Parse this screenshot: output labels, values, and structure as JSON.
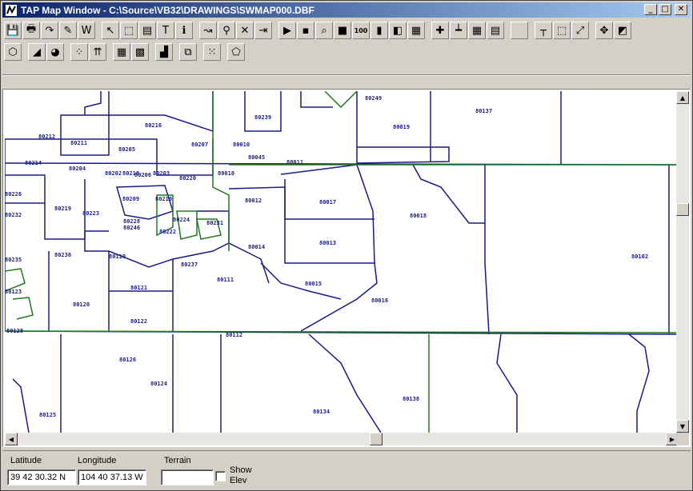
{
  "window": {
    "title": "TAP Map Window - C:\\Source\\VB32\\DRAWINGS\\SWMAP000.DBF",
    "min_label": "_",
    "max_label": "□",
    "close_label": "✕"
  },
  "toolbar1": [
    {
      "name": "save-icon",
      "glyph": "💾"
    },
    {
      "name": "print-icon",
      "glyph": "🖶"
    },
    {
      "name": "redo-icon",
      "glyph": "↷"
    },
    {
      "name": "edit-icon",
      "glyph": "✎"
    },
    {
      "name": "w-icon",
      "glyph": "W"
    },
    {
      "name": "pointer-icon",
      "glyph": "↖"
    },
    {
      "name": "select-icon",
      "glyph": "⬚"
    },
    {
      "name": "record-icon",
      "glyph": "▤"
    },
    {
      "name": "text-icon",
      "glyph": "T"
    },
    {
      "name": "info-icon",
      "glyph": "ℹ"
    },
    {
      "name": "route-icon",
      "glyph": "↝"
    },
    {
      "name": "search-map-icon",
      "glyph": "⚲"
    },
    {
      "name": "delete-icon",
      "glyph": "✕"
    },
    {
      "name": "exit-icon",
      "glyph": "⇥"
    },
    {
      "name": "green-select-icon",
      "glyph": "▶"
    },
    {
      "name": "green-dot-icon",
      "glyph": "▪"
    },
    {
      "name": "zoom-in-icon",
      "glyph": "⌕"
    },
    {
      "name": "red-box-icon",
      "glyph": "■"
    },
    {
      "name": "zoom-100-icon",
      "glyph": "100"
    },
    {
      "name": "yellow-icon",
      "glyph": "▮"
    },
    {
      "name": "layers-icon",
      "glyph": "◧"
    },
    {
      "name": "green-grid-icon",
      "glyph": "▦"
    },
    {
      "name": "crosshair-plus-icon",
      "glyph": "✚"
    },
    {
      "name": "ruler-icon",
      "glyph": "┷"
    },
    {
      "name": "grid-icon",
      "glyph": "▦"
    },
    {
      "name": "notepad-icon",
      "glyph": "▤"
    },
    {
      "name": "blank-icon",
      "glyph": ""
    },
    {
      "name": "corner-icon",
      "glyph": "┬"
    },
    {
      "name": "zoom-box-icon",
      "glyph": "⬚"
    },
    {
      "name": "expand-icon",
      "glyph": "⤢"
    },
    {
      "name": "move-icon",
      "glyph": "✥"
    },
    {
      "name": "colors-icon",
      "glyph": "◩"
    }
  ],
  "toolbar2": [
    {
      "name": "polygon-icon",
      "glyph": "⬡"
    },
    {
      "name": "area-chart-icon",
      "glyph": "◢"
    },
    {
      "name": "pie-chart-icon",
      "glyph": "◕"
    },
    {
      "name": "scatter-icon",
      "glyph": "⁘"
    },
    {
      "name": "arrows-up-icon",
      "glyph": "⇈"
    },
    {
      "name": "table-icon",
      "glyph": "▦"
    },
    {
      "name": "color-grid-icon",
      "glyph": "▩"
    },
    {
      "name": "bar-chart-icon",
      "glyph": "▟"
    },
    {
      "name": "link-icon",
      "glyph": "⧉"
    },
    {
      "name": "dot-grid-icon",
      "glyph": "⁙"
    },
    {
      "name": "green-shape-icon",
      "glyph": "⬠"
    }
  ],
  "map_labels": [
    "80249",
    "80137",
    "80239",
    "80216",
    "80019",
    "80212",
    "80211",
    "80205",
    "80207",
    "80010",
    "80045",
    "80011",
    "80214",
    "80204",
    "80202",
    "80218",
    "80206",
    "80203",
    "80220",
    "80010",
    "80226",
    "80219",
    "80223",
    "80209",
    "80210",
    "80012",
    "80017",
    "80018",
    "80232",
    "80228",
    "80246",
    "80224",
    "80222",
    "80231",
    "80014",
    "80013",
    "80102",
    "80235",
    "80236",
    "80110",
    "80237",
    "80111",
    "80015",
    "80123",
    "80121",
    "80016",
    "80120",
    "80122",
    "80128",
    "80112",
    "80126",
    "80124",
    "80138",
    "80125",
    "80134"
  ],
  "status": {
    "latitude_label": "Latitude",
    "latitude_value": "39 42 30.32 N",
    "longitude_label": "Longitude",
    "longitude_value": "104 40 37.13 W",
    "terrain_label": "Terrain",
    "terrain_value": "",
    "show_elev_label_1": "Show",
    "show_elev_label_2": "Elev"
  },
  "colors": {
    "boundary_blue": "#1a1a8a",
    "boundary_green": "#1f7a1f",
    "titlebar_start": "#0a246a"
  }
}
